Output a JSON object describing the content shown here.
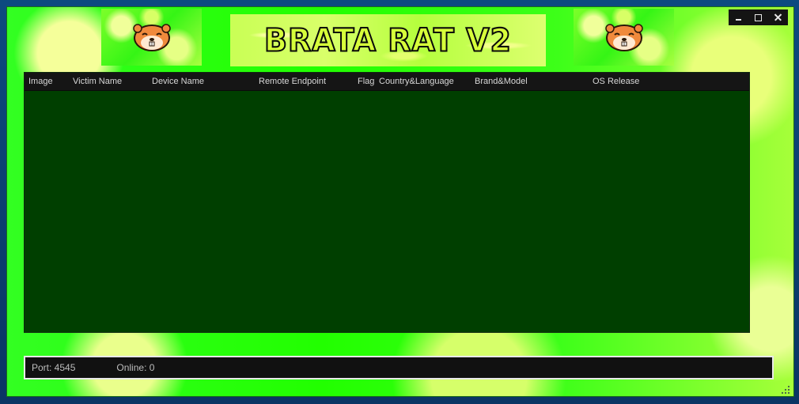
{
  "window": {
    "title": "BRATA RAT V2",
    "controls": {
      "minimize": "minimize",
      "maximize": "maximize",
      "close": "close"
    }
  },
  "banner": {
    "left_icon": "hamster-icon",
    "right_icon": "hamster-icon"
  },
  "table": {
    "columns": [
      "Image",
      "Victim Name",
      "Device Name",
      "Remote Endpoint",
      "Flag",
      "Country&Language",
      "Brand&Model",
      "OS Release"
    ],
    "rows": []
  },
  "status": {
    "port_label": "Port: 4545",
    "online_label": "Online: 0"
  },
  "colors": {
    "table_bg": "#003f00",
    "header_bg": "#151515",
    "window_green": "#22ff00",
    "title_fill": "#d7ff3a"
  }
}
